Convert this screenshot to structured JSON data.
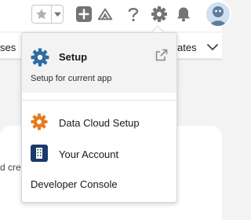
{
  "header": {
    "favorites_icon": "star-icon",
    "favorites_menu_icon": "chevron-down-icon",
    "global_actions_icon": "plus-icon",
    "trailhead_icon": "trailhead-icon",
    "help_icon": "question-icon",
    "setup_icon": "gear-icon",
    "notifications_icon": "bell-icon",
    "avatar_icon": "avatar-icon"
  },
  "nav": {
    "left_fragment": "ses",
    "right_fragment": "ates"
  },
  "background": {
    "text_fragment": "d cre"
  },
  "setup_menu": {
    "setup": {
      "title": "Setup",
      "subtitle": "Setup for current app",
      "icon": "gear-icon",
      "open_new_tab_icon": "external-link-icon"
    },
    "items": [
      {
        "label": "Data Cloud Setup",
        "icon": "gear-icon"
      },
      {
        "label": "Your Account",
        "icon": "building-icon"
      },
      {
        "label": "Developer Console"
      }
    ]
  },
  "colors": {
    "setup_gear": "#2e6da4",
    "data_cloud_gear": "#e87a1d",
    "account_tile": "#1b3a6b",
    "header_icon": "#747474"
  }
}
